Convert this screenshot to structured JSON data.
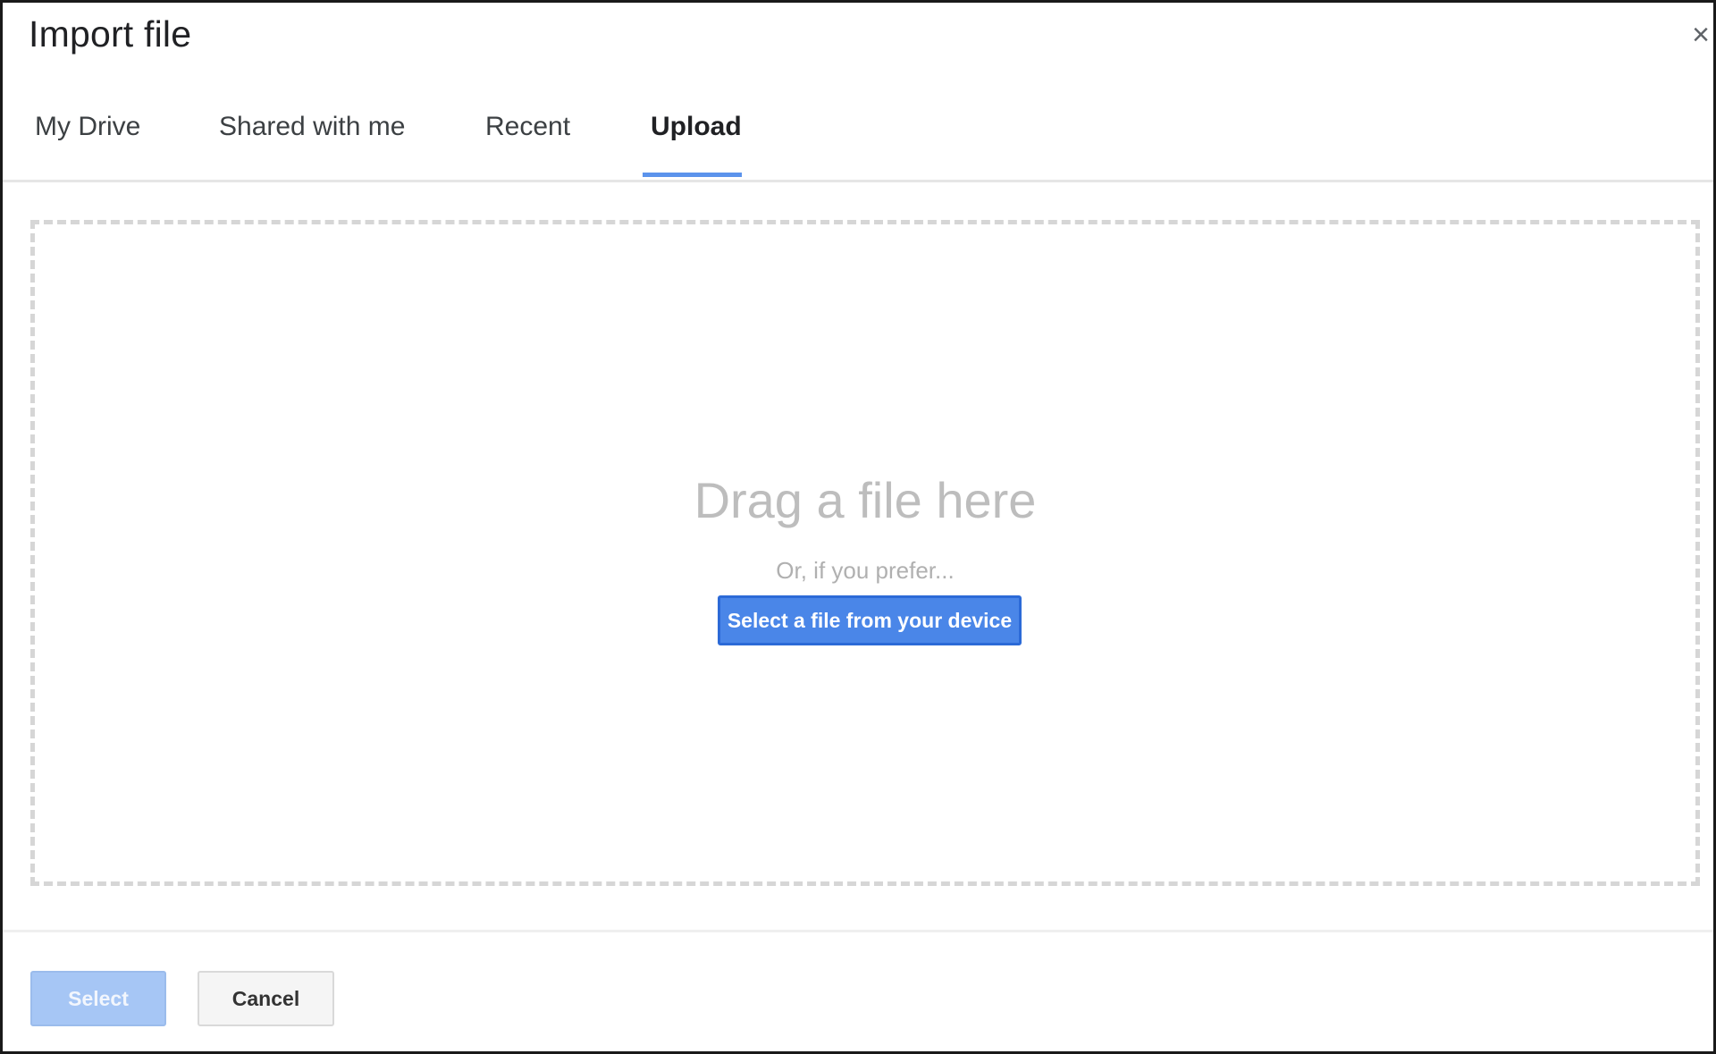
{
  "dialog": {
    "title": "Import file",
    "close_label": "×"
  },
  "tabs": [
    {
      "label": "My Drive",
      "active": false
    },
    {
      "label": "Shared with me",
      "active": false
    },
    {
      "label": "Recent",
      "active": false
    },
    {
      "label": "Upload",
      "active": true
    }
  ],
  "upload": {
    "drag_text": "Drag a file here",
    "prefer_text": "Or, if you prefer...",
    "select_file_button": "Select a file from your device"
  },
  "footer": {
    "select_label": "Select",
    "cancel_label": "Cancel"
  },
  "colors": {
    "accent": "#4a86e8",
    "tab_indicator": "#5b93ec",
    "disabled_button": "#a6c6f5"
  }
}
